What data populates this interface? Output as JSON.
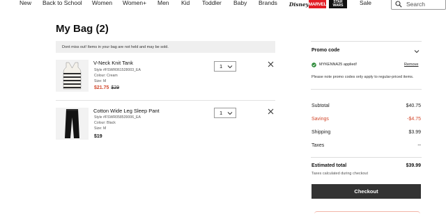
{
  "nav": {
    "items": [
      "New",
      "Back to School",
      "Women",
      "Women+",
      "Men",
      "Kid",
      "Toddler",
      "Baby",
      "Brands",
      "Sale"
    ],
    "brand_logos": [
      "Disney",
      "MARVEL",
      "STAR WARS"
    ],
    "search_placeholder": "Search"
  },
  "bag": {
    "title": "My Bag (2)",
    "notice": "Dont miss out! Items in your bag are not held and may be sold.",
    "items": [
      {
        "name": "V-Neck Knit Tank",
        "style": "Style #FSWR061528003_EA",
        "colour": "Colour: Cream",
        "size": "Size: M",
        "price_sale": "$21.75",
        "price_original": "$29",
        "quantity": "1"
      },
      {
        "name": "Cotton Wide Leg Sleep Pant",
        "style": "Style #FSWR058539006_EA",
        "colour": "Colour: Black",
        "size": "Size: M",
        "price": "$19",
        "quantity": "1"
      }
    ]
  },
  "summary": {
    "promo_title": "Promo code",
    "promo_applied": "MYKENNA25 applied!",
    "promo_remove": "Remove",
    "promo_note": "Please note promo codes only apply to regular-priced items.",
    "subtotal_label": "Subtotal",
    "subtotal_value": "$40.75",
    "savings_label": "Savings",
    "savings_value": "-$4.75",
    "shipping_label": "Shipping",
    "shipping_value": "$3.99",
    "taxes_label": "Taxes",
    "taxes_value": "--",
    "total_label": "Estimated total",
    "total_value": "$39.99",
    "tax_note": "Taxes calculated during checkout",
    "checkout_label": "Checkout"
  },
  "colors": {
    "sale_red": "#d2462a",
    "checkout_bg": "#333333",
    "notice_bg": "#efefef",
    "promo_check_green": "#2e8b3a"
  }
}
